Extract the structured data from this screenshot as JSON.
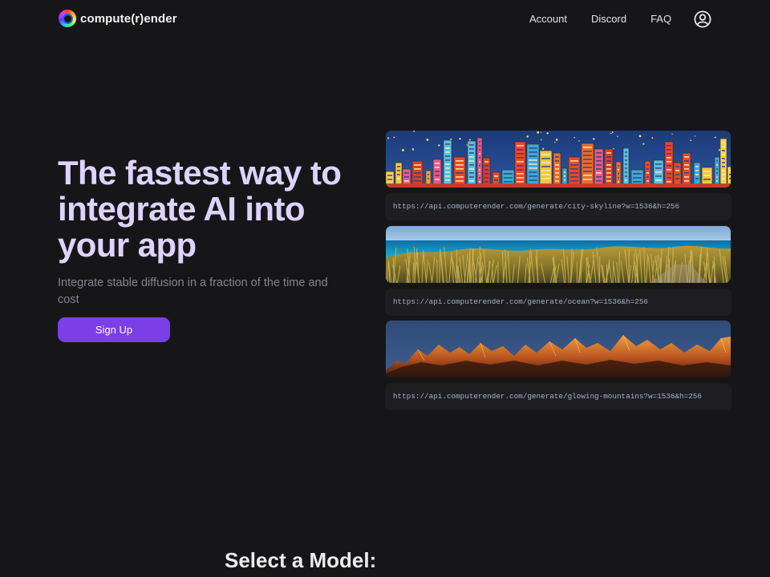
{
  "header": {
    "brand": "compute(r)ender",
    "nav": [
      {
        "label": "Account"
      },
      {
        "label": "Discord"
      },
      {
        "label": "FAQ"
      }
    ]
  },
  "hero": {
    "title": "The fastest way to integrate AI into your app",
    "subtitle": "Integrate stable diffusion in a fraction of the time and cost",
    "cta": "Sign Up"
  },
  "examples": [
    {
      "name": "city-skyline",
      "url": "https://api.computerender.com/generate/city-skyline?w=1536&h=256"
    },
    {
      "name": "ocean",
      "url": "https://api.computerender.com/generate/ocean?w=1536&h=256"
    },
    {
      "name": "glowing-mountains",
      "url": "https://api.computerender.com/generate/glowing-mountains?w=1536&h=256"
    }
  ],
  "models": {
    "heading": "Select a Model:"
  },
  "colors": {
    "background": "#161618",
    "accent": "#7b3fe8",
    "title": "#ddd3ff"
  }
}
